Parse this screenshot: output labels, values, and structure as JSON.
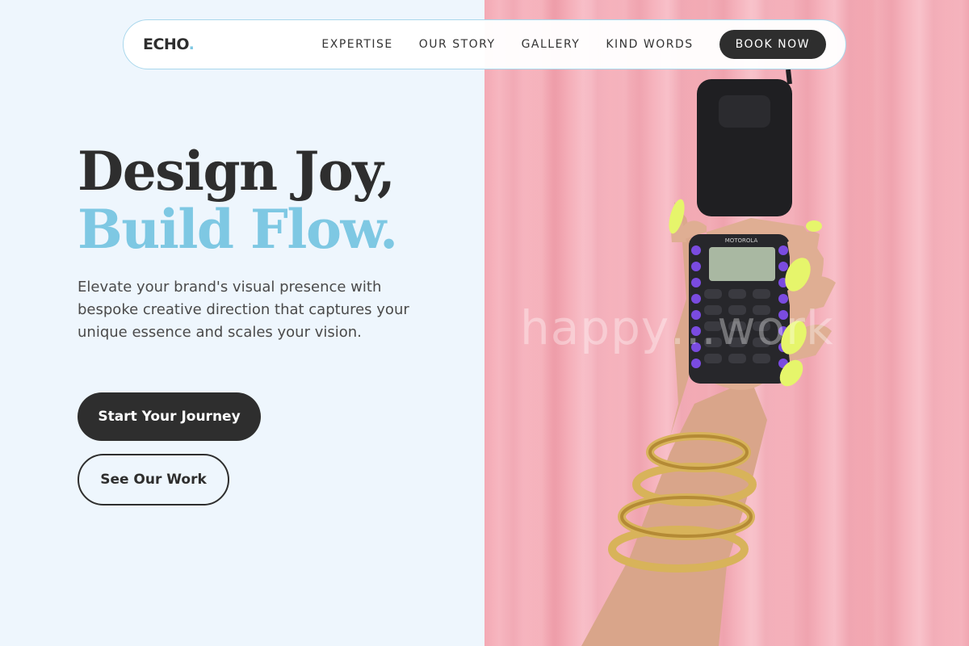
{
  "brand": {
    "name": "ECHO",
    "dot": ".",
    "accent_color": "#7ec8e3",
    "dark_color": "#2e2e2e"
  },
  "nav": {
    "links": [
      "EXPERTISE",
      "OUR STORY",
      "GALLERY",
      "KIND WORDS"
    ],
    "cta": "BOOK NOW"
  },
  "hero": {
    "headline_line1": "Design Joy,",
    "headline_line2": "Build Flow.",
    "lead": "Elevate your brand's visual presence with bespoke creative direction that captures your unique essence and scales your vision.",
    "primary_cta": "Start Your Journey",
    "secondary_cta": "See Our Work"
  },
  "image": {
    "description_icon": "photo-hand-holding-flip-phone",
    "phone_brand": "MOTOROLA",
    "watermark": "happy…work",
    "background_color": "#f4a9b4"
  }
}
